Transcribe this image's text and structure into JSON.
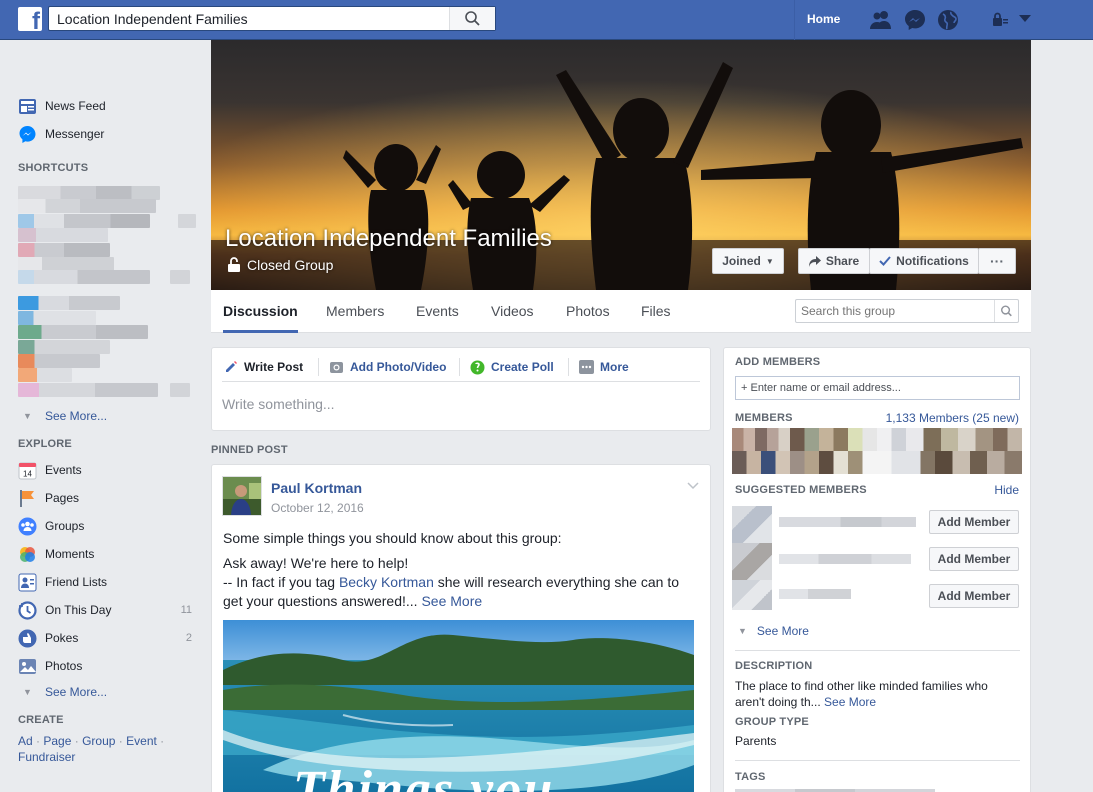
{
  "topbar": {
    "logo": "f",
    "search_value": "Location Independent Families",
    "home_label": "Home"
  },
  "left_nav": {
    "items": [
      {
        "label": "News Feed",
        "icon": "news-feed-icon"
      },
      {
        "label": "Messenger",
        "icon": "messenger-icon"
      }
    ],
    "shortcuts_heading": "SHORTCUTS",
    "see_more_1": "See More...",
    "explore_heading": "EXPLORE",
    "explore": [
      {
        "label": "Events",
        "icon": "events-icon",
        "count": ""
      },
      {
        "label": "Pages",
        "icon": "pages-icon",
        "count": ""
      },
      {
        "label": "Groups",
        "icon": "groups-icon",
        "count": ""
      },
      {
        "label": "Moments",
        "icon": "moments-icon",
        "count": ""
      },
      {
        "label": "Friend Lists",
        "icon": "friend-lists-icon",
        "count": ""
      },
      {
        "label": "On This Day",
        "icon": "on-this-day-icon",
        "count": "11"
      },
      {
        "label": "Pokes",
        "icon": "pokes-icon",
        "count": "2"
      },
      {
        "label": "Photos",
        "icon": "photos-icon",
        "count": ""
      }
    ],
    "events_day": "14",
    "see_more_2": "See More...",
    "create_heading": "CREATE",
    "create_links": [
      "Ad",
      "Page",
      "Group",
      "Event",
      "Fundraiser"
    ],
    "sep": "·"
  },
  "cover": {
    "title": "Location Independent Families",
    "privacy": "Closed Group",
    "joined_label": "Joined",
    "share_label": "Share",
    "notifications_label": "Notifications",
    "more_label": "···"
  },
  "tabs": [
    "Discussion",
    "Members",
    "Events",
    "Videos",
    "Photos",
    "Files"
  ],
  "group_search_placeholder": "Search this group",
  "composer": {
    "write_post": "Write Post",
    "add_photo": "Add Photo/Video",
    "create_poll": "Create Poll",
    "more": "More",
    "placeholder": "Write something..."
  },
  "pinned": {
    "heading": "PINNED POST",
    "author": "Paul Kortman",
    "date": "October 12, 2016",
    "line1": "Some simple things you should know about this group:",
    "line2": "Ask away! We're here to help!",
    "line3_pre": "-- In fact if you tag ",
    "line3_link": "Becky Kortman",
    "line3_post": " she will research everything she can to",
    "line4": "get your questions answered!...",
    "see_more": "See More",
    "image_text": "Things you"
  },
  "right": {
    "add_members_heading": "ADD MEMBERS",
    "add_members_placeholder": "+ Enter name or email address...",
    "members_heading": "MEMBERS",
    "members_count": "1,133 Members (25 new)",
    "suggested_heading": "SUGGESTED MEMBERS",
    "hide_label": "Hide",
    "add_member_label": "Add Member",
    "see_more": "See More",
    "description_heading": "DESCRIPTION",
    "description_text1": "The place to find other like minded families who",
    "description_text2": "aren't doing th...",
    "description_see_more": "See More",
    "group_type_heading": "GROUP TYPE",
    "group_type": "Parents",
    "tags_heading": "TAGS"
  },
  "colors": {
    "brand": "#4267b2",
    "link": "#365899",
    "background": "#e9ebee"
  }
}
